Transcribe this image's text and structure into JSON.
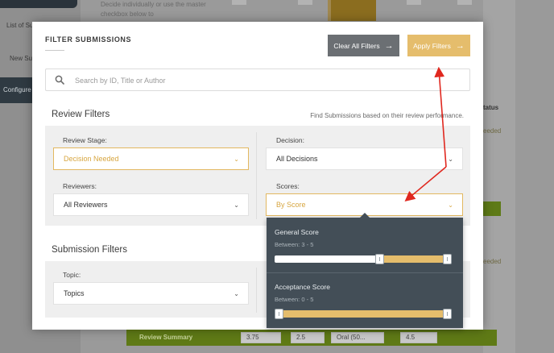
{
  "background": {
    "sidebar": {
      "items": [
        "List of Su",
        "New Su",
        "Configure"
      ]
    },
    "description_text": "Decide individually or use the master checkbox below to",
    "right_column": {
      "header": "tatus",
      "labels": [
        "eeded",
        "eeded"
      ]
    },
    "review_summary": {
      "label": "Review Summary",
      "cells": [
        "3.75",
        "2.5",
        "Oral (50...",
        "4.5"
      ]
    }
  },
  "modal": {
    "title": "FILTER SUBMISSIONS",
    "clear_button": "Clear All Filters",
    "apply_button": "Apply Filters",
    "arrow_glyph": "→",
    "search": {
      "placeholder": "Search by ID, Title or Author",
      "value": ""
    },
    "review_filters": {
      "title": "Review Filters",
      "hint": "Find Submissions based on their review performance.",
      "review_stage": {
        "label": "Review Stage:",
        "value": "Decision Needed"
      },
      "decision": {
        "label": "Decision:",
        "value": "All Decisions"
      },
      "reviewers": {
        "label": "Reviewers:",
        "value": "All Reviewers"
      },
      "scores": {
        "label": "Scores:",
        "value": "By Score"
      }
    },
    "submission_filters": {
      "title": "Submission Filters",
      "topic": {
        "label": "Topic:",
        "value": "Topics"
      }
    },
    "score_dropdown": {
      "general": {
        "name": "General Score",
        "range_text": "Between: 3 - 5",
        "min": 0,
        "max": 5,
        "low": 3,
        "high": 5
      },
      "acceptance": {
        "name": "Acceptance Score",
        "range_text": "Between: 0 - 5",
        "min": 0,
        "max": 5,
        "low": 0,
        "high": 5
      }
    }
  },
  "colors": {
    "accent_gold": "#e5bd6c",
    "dark_button": "#6b6f73",
    "dropdown_bg": "#434e57",
    "annotation_red": "#e0281f"
  },
  "icons": {
    "search": "search-icon",
    "chevron": "chevron-down-icon",
    "arrow": "arrow-right-icon"
  }
}
